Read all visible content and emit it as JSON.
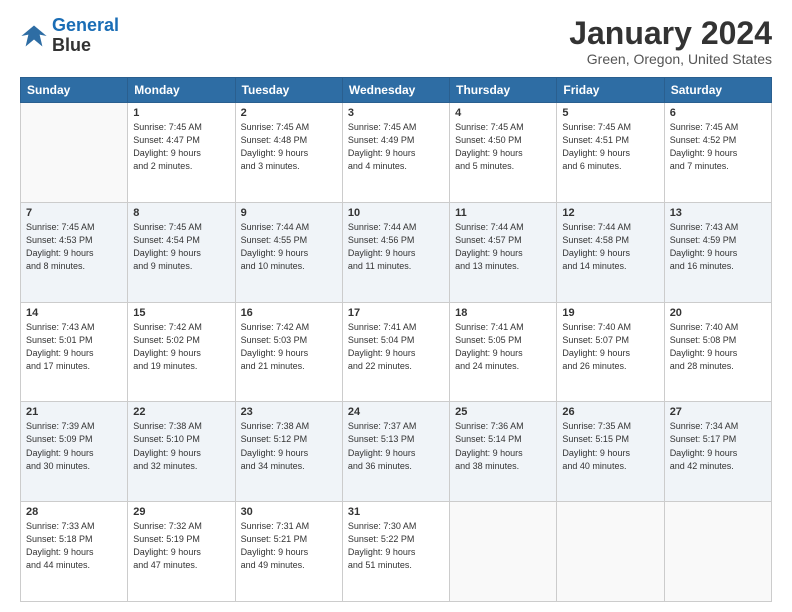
{
  "logo": {
    "line1": "General",
    "line2": "Blue"
  },
  "title": "January 2024",
  "subtitle": "Green, Oregon, United States",
  "days_of_week": [
    "Sunday",
    "Monday",
    "Tuesday",
    "Wednesday",
    "Thursday",
    "Friday",
    "Saturday"
  ],
  "weeks": [
    [
      {
        "day": "",
        "info": ""
      },
      {
        "day": "1",
        "info": "Sunrise: 7:45 AM\nSunset: 4:47 PM\nDaylight: 9 hours\nand 2 minutes."
      },
      {
        "day": "2",
        "info": "Sunrise: 7:45 AM\nSunset: 4:48 PM\nDaylight: 9 hours\nand 3 minutes."
      },
      {
        "day": "3",
        "info": "Sunrise: 7:45 AM\nSunset: 4:49 PM\nDaylight: 9 hours\nand 4 minutes."
      },
      {
        "day": "4",
        "info": "Sunrise: 7:45 AM\nSunset: 4:50 PM\nDaylight: 9 hours\nand 5 minutes."
      },
      {
        "day": "5",
        "info": "Sunrise: 7:45 AM\nSunset: 4:51 PM\nDaylight: 9 hours\nand 6 minutes."
      },
      {
        "day": "6",
        "info": "Sunrise: 7:45 AM\nSunset: 4:52 PM\nDaylight: 9 hours\nand 7 minutes."
      }
    ],
    [
      {
        "day": "7",
        "info": "Sunrise: 7:45 AM\nSunset: 4:53 PM\nDaylight: 9 hours\nand 8 minutes."
      },
      {
        "day": "8",
        "info": "Sunrise: 7:45 AM\nSunset: 4:54 PM\nDaylight: 9 hours\nand 9 minutes."
      },
      {
        "day": "9",
        "info": "Sunrise: 7:44 AM\nSunset: 4:55 PM\nDaylight: 9 hours\nand 10 minutes."
      },
      {
        "day": "10",
        "info": "Sunrise: 7:44 AM\nSunset: 4:56 PM\nDaylight: 9 hours\nand 11 minutes."
      },
      {
        "day": "11",
        "info": "Sunrise: 7:44 AM\nSunset: 4:57 PM\nDaylight: 9 hours\nand 13 minutes."
      },
      {
        "day": "12",
        "info": "Sunrise: 7:44 AM\nSunset: 4:58 PM\nDaylight: 9 hours\nand 14 minutes."
      },
      {
        "day": "13",
        "info": "Sunrise: 7:43 AM\nSunset: 4:59 PM\nDaylight: 9 hours\nand 16 minutes."
      }
    ],
    [
      {
        "day": "14",
        "info": "Sunrise: 7:43 AM\nSunset: 5:01 PM\nDaylight: 9 hours\nand 17 minutes."
      },
      {
        "day": "15",
        "info": "Sunrise: 7:42 AM\nSunset: 5:02 PM\nDaylight: 9 hours\nand 19 minutes."
      },
      {
        "day": "16",
        "info": "Sunrise: 7:42 AM\nSunset: 5:03 PM\nDaylight: 9 hours\nand 21 minutes."
      },
      {
        "day": "17",
        "info": "Sunrise: 7:41 AM\nSunset: 5:04 PM\nDaylight: 9 hours\nand 22 minutes."
      },
      {
        "day": "18",
        "info": "Sunrise: 7:41 AM\nSunset: 5:05 PM\nDaylight: 9 hours\nand 24 minutes."
      },
      {
        "day": "19",
        "info": "Sunrise: 7:40 AM\nSunset: 5:07 PM\nDaylight: 9 hours\nand 26 minutes."
      },
      {
        "day": "20",
        "info": "Sunrise: 7:40 AM\nSunset: 5:08 PM\nDaylight: 9 hours\nand 28 minutes."
      }
    ],
    [
      {
        "day": "21",
        "info": "Sunrise: 7:39 AM\nSunset: 5:09 PM\nDaylight: 9 hours\nand 30 minutes."
      },
      {
        "day": "22",
        "info": "Sunrise: 7:38 AM\nSunset: 5:10 PM\nDaylight: 9 hours\nand 32 minutes."
      },
      {
        "day": "23",
        "info": "Sunrise: 7:38 AM\nSunset: 5:12 PM\nDaylight: 9 hours\nand 34 minutes."
      },
      {
        "day": "24",
        "info": "Sunrise: 7:37 AM\nSunset: 5:13 PM\nDaylight: 9 hours\nand 36 minutes."
      },
      {
        "day": "25",
        "info": "Sunrise: 7:36 AM\nSunset: 5:14 PM\nDaylight: 9 hours\nand 38 minutes."
      },
      {
        "day": "26",
        "info": "Sunrise: 7:35 AM\nSunset: 5:15 PM\nDaylight: 9 hours\nand 40 minutes."
      },
      {
        "day": "27",
        "info": "Sunrise: 7:34 AM\nSunset: 5:17 PM\nDaylight: 9 hours\nand 42 minutes."
      }
    ],
    [
      {
        "day": "28",
        "info": "Sunrise: 7:33 AM\nSunset: 5:18 PM\nDaylight: 9 hours\nand 44 minutes."
      },
      {
        "day": "29",
        "info": "Sunrise: 7:32 AM\nSunset: 5:19 PM\nDaylight: 9 hours\nand 47 minutes."
      },
      {
        "day": "30",
        "info": "Sunrise: 7:31 AM\nSunset: 5:21 PM\nDaylight: 9 hours\nand 49 minutes."
      },
      {
        "day": "31",
        "info": "Sunrise: 7:30 AM\nSunset: 5:22 PM\nDaylight: 9 hours\nand 51 minutes."
      },
      {
        "day": "",
        "info": ""
      },
      {
        "day": "",
        "info": ""
      },
      {
        "day": "",
        "info": ""
      }
    ]
  ]
}
